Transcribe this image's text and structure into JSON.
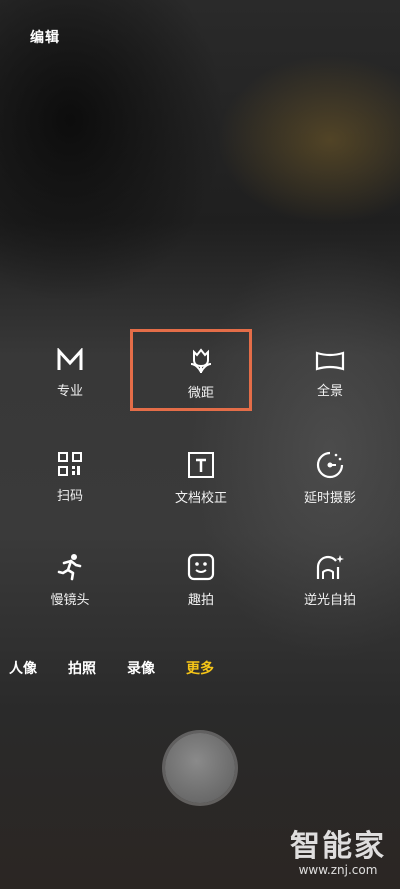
{
  "header": {
    "edit_label": "编辑"
  },
  "modes": [
    {
      "label": "专业",
      "icon": "pro-mode-icon"
    },
    {
      "label": "微距",
      "icon": "macro-tulip-icon"
    },
    {
      "label": "全景",
      "icon": "panorama-icon"
    },
    {
      "label": "扫码",
      "icon": "qr-scan-icon"
    },
    {
      "label": "文档校正",
      "icon": "document-correction-icon"
    },
    {
      "label": "延时摄影",
      "icon": "timelapse-icon"
    },
    {
      "label": "慢镜头",
      "icon": "slow-motion-runner-icon"
    },
    {
      "label": "趣拍",
      "icon": "fun-shot-face-icon"
    },
    {
      "label": "逆光自拍",
      "icon": "backlight-selfie-icon"
    }
  ],
  "highlight_color": "#e46d48",
  "tabs": [
    {
      "label": "人像",
      "active": false
    },
    {
      "label": "拍照",
      "active": false
    },
    {
      "label": "录像",
      "active": false
    },
    {
      "label": "更多",
      "active": true
    }
  ],
  "active_tab_color": "#f5c518",
  "watermark": {
    "logo": "智能家",
    "url": "www.znj.com"
  }
}
